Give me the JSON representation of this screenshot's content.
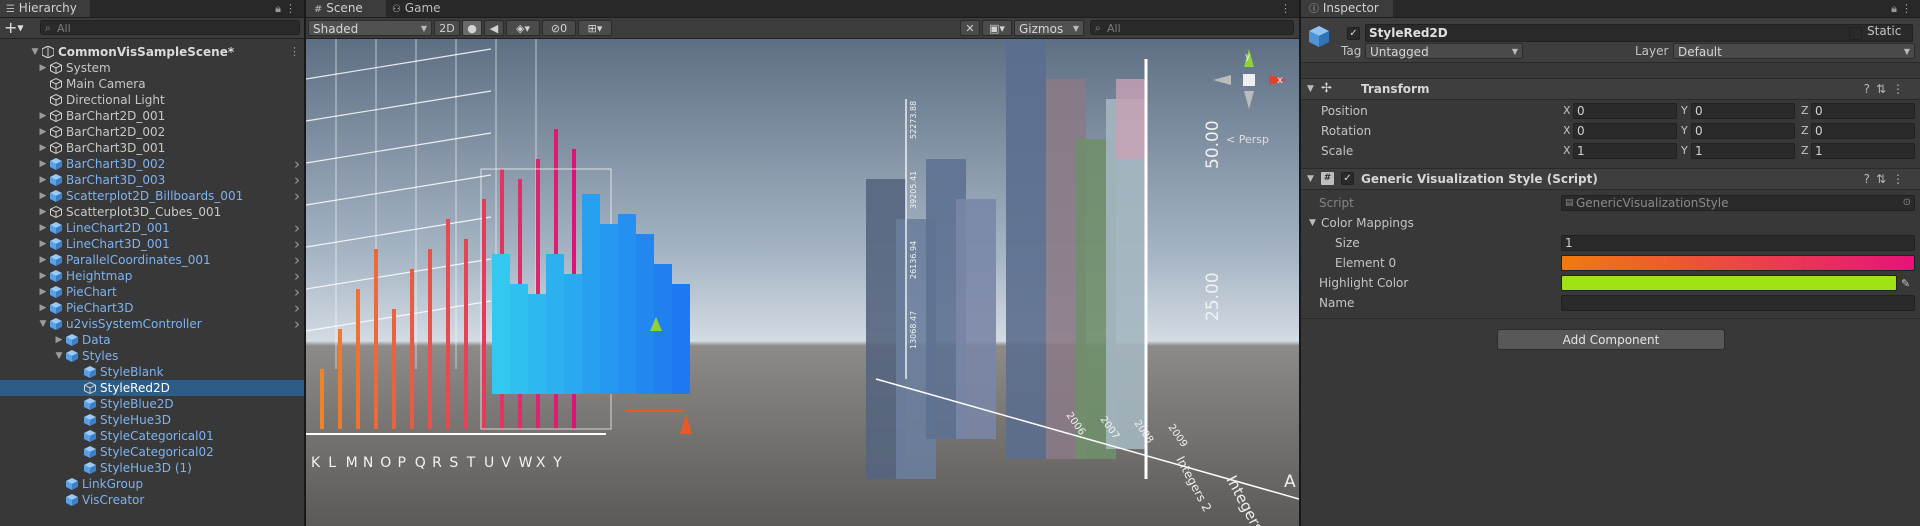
{
  "hierarchy": {
    "tab_label": "Hierarchy",
    "search_placeholder": "All",
    "add_label": "+",
    "rows": [
      {
        "label": "CommonVisSampleScene*",
        "depth": 0,
        "arrow": "down",
        "kind": "scene",
        "chevron": false,
        "selected": false
      },
      {
        "label": "System",
        "depth": 1,
        "arrow": "right",
        "kind": "normal",
        "chevron": false,
        "selected": false
      },
      {
        "label": "Main Camera",
        "depth": 1,
        "arrow": "",
        "kind": "normal",
        "chevron": false,
        "selected": false
      },
      {
        "label": "Directional Light",
        "depth": 1,
        "arrow": "",
        "kind": "normal",
        "chevron": false,
        "selected": false
      },
      {
        "label": "BarChart2D_001",
        "depth": 1,
        "arrow": "right",
        "kind": "normal",
        "chevron": false,
        "selected": false
      },
      {
        "label": "BarChart2D_002",
        "depth": 1,
        "arrow": "right",
        "kind": "normal",
        "chevron": false,
        "selected": false
      },
      {
        "label": "BarChart3D_001",
        "depth": 1,
        "arrow": "right",
        "kind": "normal",
        "chevron": false,
        "selected": false
      },
      {
        "label": "BarChart3D_002",
        "depth": 1,
        "arrow": "right",
        "kind": "prefab",
        "chevron": true,
        "selected": false
      },
      {
        "label": "BarChart3D_003",
        "depth": 1,
        "arrow": "right",
        "kind": "prefab",
        "chevron": true,
        "selected": false
      },
      {
        "label": "Scatterplot2D_Billboards_001",
        "depth": 1,
        "arrow": "right",
        "kind": "prefab",
        "chevron": true,
        "selected": false
      },
      {
        "label": "Scatterplot3D_Cubes_001",
        "depth": 1,
        "arrow": "right",
        "kind": "normal",
        "chevron": false,
        "selected": false
      },
      {
        "label": "LineChart2D_001",
        "depth": 1,
        "arrow": "right",
        "kind": "prefab",
        "chevron": true,
        "selected": false
      },
      {
        "label": "LineChart3D_001",
        "depth": 1,
        "arrow": "right",
        "kind": "prefab",
        "chevron": true,
        "selected": false
      },
      {
        "label": "ParallelCoordinates_001",
        "depth": 1,
        "arrow": "right",
        "kind": "prefab",
        "chevron": true,
        "selected": false
      },
      {
        "label": "Heightmap",
        "depth": 1,
        "arrow": "right",
        "kind": "prefab",
        "chevron": true,
        "selected": false
      },
      {
        "label": "PieChart",
        "depth": 1,
        "arrow": "right",
        "kind": "prefab",
        "chevron": true,
        "selected": false
      },
      {
        "label": "PieChart3D",
        "depth": 1,
        "arrow": "right",
        "kind": "prefab",
        "chevron": true,
        "selected": false
      },
      {
        "label": "u2visSystemController",
        "depth": 1,
        "arrow": "down",
        "kind": "prefab",
        "chevron": true,
        "selected": false
      },
      {
        "label": "Data",
        "depth": 2,
        "arrow": "right",
        "kind": "prefab",
        "chevron": false,
        "selected": false
      },
      {
        "label": "Styles",
        "depth": 2,
        "arrow": "down",
        "kind": "prefab",
        "chevron": false,
        "selected": false
      },
      {
        "label": "StyleBlank",
        "depth": 3,
        "arrow": "",
        "kind": "prefab",
        "chevron": false,
        "selected": false
      },
      {
        "label": "StyleRed2D",
        "depth": 3,
        "arrow": "",
        "kind": "normal",
        "chevron": false,
        "selected": true
      },
      {
        "label": "StyleBlue2D",
        "depth": 3,
        "arrow": "",
        "kind": "prefab",
        "chevron": false,
        "selected": false
      },
      {
        "label": "StyleHue3D",
        "depth": 3,
        "arrow": "",
        "kind": "prefab",
        "chevron": false,
        "selected": false
      },
      {
        "label": "StyleCategorical01",
        "depth": 3,
        "arrow": "",
        "kind": "prefab",
        "chevron": false,
        "selected": false
      },
      {
        "label": "StyleCategorical02",
        "depth": 3,
        "arrow": "",
        "kind": "prefab",
        "chevron": false,
        "selected": false
      },
      {
        "label": "StyleHue3D (1)",
        "depth": 3,
        "arrow": "",
        "kind": "prefab",
        "chevron": false,
        "selected": false
      },
      {
        "label": "LinkGroup",
        "depth": 2,
        "arrow": "",
        "kind": "prefab",
        "chevron": false,
        "selected": false
      },
      {
        "label": "VisCreator",
        "depth": 2,
        "arrow": "",
        "kind": "prefab",
        "chevron": false,
        "selected": false
      }
    ]
  },
  "scene": {
    "tabs": [
      {
        "label": "Scene",
        "icon": "hash-icon"
      },
      {
        "label": "Game",
        "icon": "gamepad-icon"
      }
    ],
    "shading_mode": "Shaded",
    "mode_2d_label": "2D",
    "hidden_count": "0",
    "gizmos_label": "Gizmos",
    "search_placeholder": "All",
    "persp_label": "< Persp",
    "view_labels": {
      "letters": [
        "K",
        "L",
        "M",
        "N",
        "O",
        "P",
        "Q",
        "R",
        "S",
        "T",
        "U",
        "V",
        "W",
        "X",
        "Y"
      ],
      "height_50": "50.00",
      "height_25": "25.00",
      "years": [
        "2006",
        "2007",
        "2008",
        "2009"
      ],
      "integers_label": "Integers 2",
      "integers_label2": "Integers",
      "axis_letter_a": "A",
      "tick_values": [
        "52273.88",
        "39205.41",
        "26136.94",
        "13068.47"
      ]
    }
  },
  "inspector": {
    "tab_label": "Inspector",
    "object_name": "StyleRed2D",
    "active": true,
    "static_label": "Static",
    "tag_label": "Tag",
    "tag_value": "Untagged",
    "layer_label": "Layer",
    "layer_value": "Default",
    "transform": {
      "title": "Transform",
      "rows": [
        {
          "label": "Position",
          "x": "0",
          "y": "0",
          "z": "0"
        },
        {
          "label": "Rotation",
          "x": "0",
          "y": "0",
          "z": "0"
        },
        {
          "label": "Scale",
          "x": "1",
          "y": "1",
          "z": "1"
        }
      ],
      "axis_x": "X",
      "axis_y": "Y",
      "axis_z": "Z"
    },
    "script_component": {
      "title": "Generic Visualization Style (Script)",
      "script_label": "Script",
      "script_value": "GenericVisualizationStyle",
      "color_mappings_label": "Color Mappings",
      "size_label": "Size",
      "size_value": "1",
      "element0_label": "Element 0",
      "gradient_colors": [
        "#f07a10",
        "#e8127a"
      ],
      "highlight_label": "Highlight Color",
      "highlight_color": "#9fe315",
      "name_label": "Name",
      "name_value": ""
    },
    "add_component_label": "Add Component"
  }
}
